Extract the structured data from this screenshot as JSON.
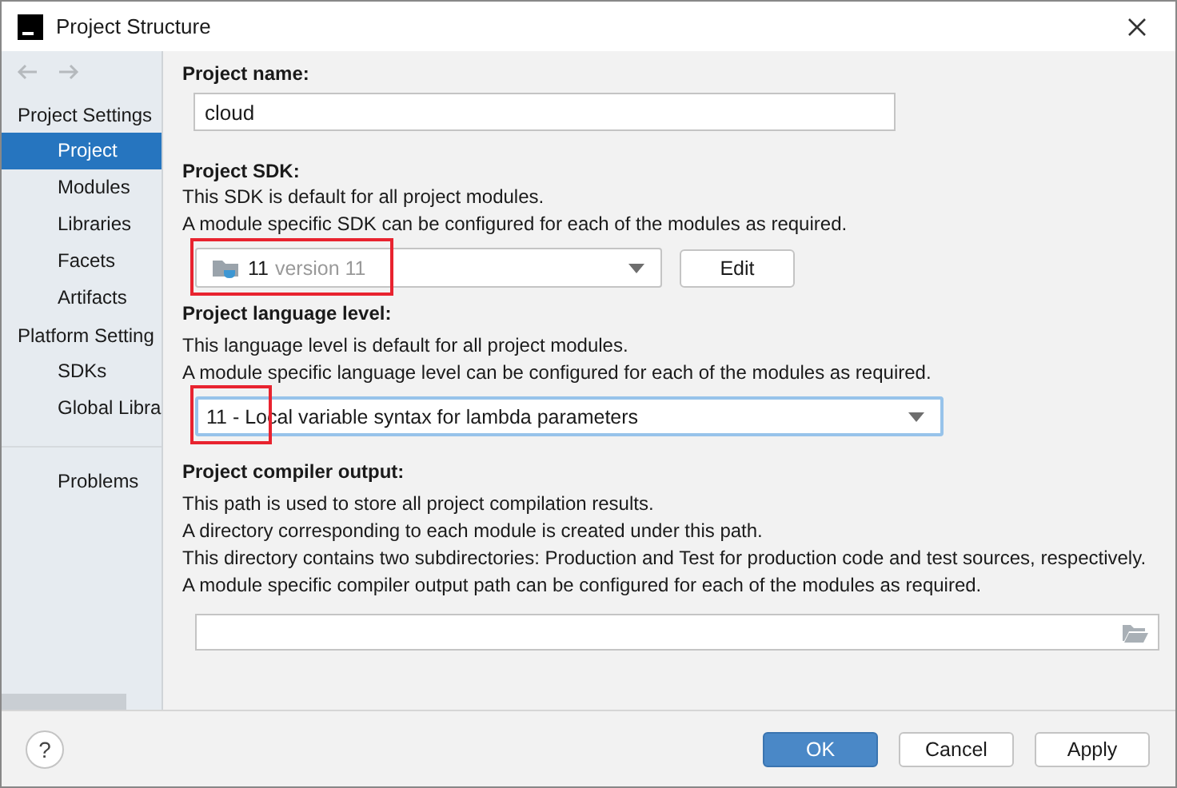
{
  "window": {
    "title": "Project Structure"
  },
  "sidebar": {
    "sections": [
      {
        "title": "Project Settings",
        "items": [
          {
            "label": "Project",
            "selected": true
          },
          {
            "label": "Modules",
            "selected": false
          },
          {
            "label": "Libraries",
            "selected": false
          },
          {
            "label": "Facets",
            "selected": false
          },
          {
            "label": "Artifacts",
            "selected": false
          }
        ]
      },
      {
        "title": "Platform Setting",
        "items": [
          {
            "label": "SDKs",
            "selected": false
          },
          {
            "label": "Global Libra",
            "selected": false
          }
        ]
      }
    ],
    "bottom_items": [
      {
        "label": "Problems",
        "selected": false
      }
    ]
  },
  "project_name": {
    "label": "Project name:",
    "value": "cloud"
  },
  "project_sdk": {
    "label": "Project SDK:",
    "notes": [
      "This SDK is default for all project modules.",
      "A module specific SDK can be configured for each of the modules as required."
    ],
    "dropdown": {
      "value": "11",
      "detail": "version 11",
      "highlighted": true
    },
    "edit_button": "Edit"
  },
  "language_level": {
    "label": "Project language level:",
    "notes": [
      "This language level is default for all project modules.",
      "A module specific language level can be configured for each of the modules as required."
    ],
    "dropdown": {
      "value": "11 - Local variable syntax for lambda parameters",
      "highlighted": true
    }
  },
  "compiler_output": {
    "label": "Project compiler output:",
    "notes": [
      "This path is used to store all project compilation results.",
      "A directory corresponding to each module is created under this path.",
      "This directory contains two subdirectories: Production and Test for production code and test sources, respectively.",
      "A module specific compiler output path can be configured for each of the modules as required."
    ]
  },
  "help_button": "?",
  "buttons": [
    {
      "label": "OK",
      "kind": "primary"
    },
    {
      "label": "Cancel",
      "kind": "normal"
    },
    {
      "label": "Apply",
      "kind": "normal"
    }
  ]
}
